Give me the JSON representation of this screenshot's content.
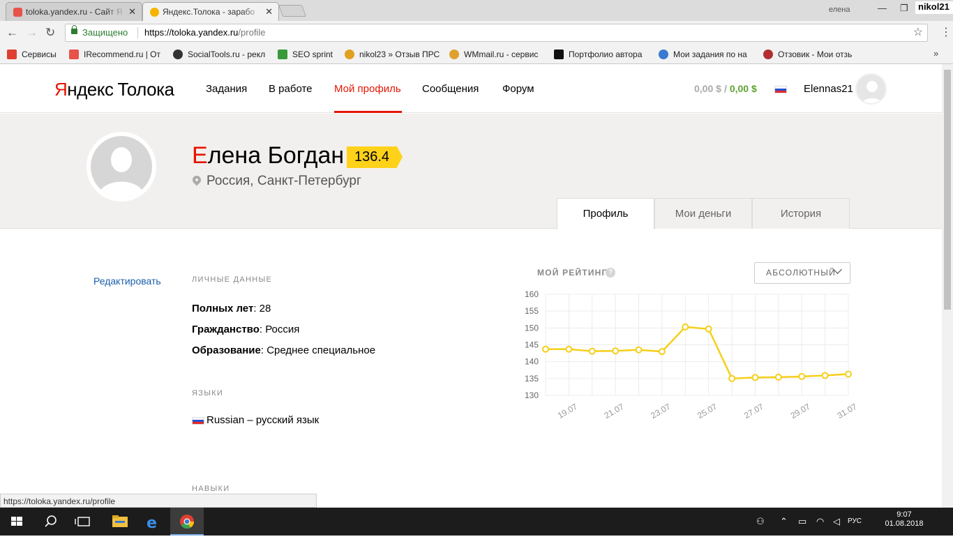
{
  "browser": {
    "tabs": [
      {
        "title": "toloka.yandex.ru - Сайт Я",
        "active": false,
        "favicon_color": "#e8524a"
      },
      {
        "title": "Яндекс.Толока - зарабо",
        "active": true,
        "favicon_color": "#f5b400"
      }
    ],
    "window_user": "елена",
    "overlay_username": "nikol21",
    "secure_label": "Защищено",
    "url_scheme_host": "https://toloka.yandex.ru",
    "url_path": "/profile",
    "bookmarks": [
      {
        "label": "Сервисы",
        "color": "#e04030"
      },
      {
        "label": "IRecommend.ru | От",
        "color": "#e8524a"
      },
      {
        "label": "SocialTools.ru - рекл",
        "color": "#333333"
      },
      {
        "label": "SEO sprint",
        "color": "#3a9a3a"
      },
      {
        "label": "nikol23 » Отзыв ПРС",
        "color": "#e0a020"
      },
      {
        "label": "WMmail.ru - сервис",
        "color": "#e0a030"
      },
      {
        "label": "Портфолио автора",
        "color": "#111111"
      },
      {
        "label": "Мои задания по на",
        "color": "#3a7ad0"
      },
      {
        "label": "Отзовик - Мои отзь",
        "color": "#b03030"
      }
    ],
    "status_url": "https://toloka.yandex.ru/profile"
  },
  "header": {
    "logo_yandex_first": "Я",
    "logo_yandex_rest": "ндекс",
    "logo_product": "Толока",
    "nav": [
      "Задания",
      "В работе",
      "Мой профиль",
      "Сообщения",
      "Форум"
    ],
    "balance_1": "0,00 $",
    "balance_sep": "/",
    "balance_2": "0,00 $",
    "username": "Elennas21"
  },
  "profile": {
    "name_first_letter": "Е",
    "name_rest": "лена Богдан",
    "rating": "136.4",
    "location": "Россия, Санкт-Петербург",
    "tabs": [
      "Профиль",
      "Мои деньги",
      "История"
    ],
    "edit_label": "Редактировать",
    "personal_heading": "ЛИЧНЫЕ ДАННЫЕ",
    "age_label": "Полных лет",
    "age_value": ": 28",
    "citizenship_label": "Гражданство",
    "citizenship_value": ": Россия",
    "education_label": "Образование",
    "education_value": ": Среднее специальное",
    "languages_heading": "ЯЗЫКИ",
    "language": "Russian – русский язык",
    "skills_heading": "НАВЫКИ"
  },
  "rating_widget": {
    "title": "МОЙ РЕЙТИНГ",
    "help": "?",
    "scale_option": "АБСОЛЮТНЫЙ"
  },
  "chart_data": {
    "type": "line",
    "x": [
      "18.07",
      "19.07",
      "20.07",
      "21.07",
      "22.07",
      "23.07",
      "24.07",
      "25.07",
      "26.07",
      "27.07",
      "28.07",
      "29.07",
      "30.07",
      "31.07"
    ],
    "tick_labels": [
      "19.07",
      "21.07",
      "23.07",
      "25.07",
      "27.07",
      "29.07",
      "31.07"
    ],
    "values": [
      143.7,
      143.7,
      143.1,
      143.2,
      143.5,
      143.0,
      150.3,
      149.7,
      135.0,
      135.3,
      135.4,
      135.6,
      135.9,
      136.3
    ],
    "ylim": [
      130,
      160
    ],
    "yticks": [
      130,
      135,
      140,
      145,
      150,
      155,
      160
    ],
    "grid": true,
    "color": "#f5cf1a"
  },
  "taskbar": {
    "time": "9:07",
    "date": "01.08.2018",
    "lang": "РУС"
  }
}
